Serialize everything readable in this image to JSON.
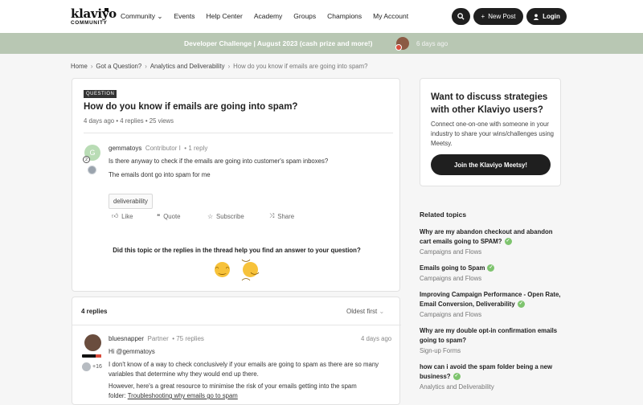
{
  "brand": {
    "name": "klaviyo",
    "sub": "COMMUNITY"
  },
  "nav": [
    "Community",
    "Events",
    "Help Center",
    "Academy",
    "Groups",
    "Champions",
    "My Account"
  ],
  "header_buttons": {
    "new_post": "New Post",
    "login": "Login"
  },
  "banner": {
    "text": "Developer Challenge | August 2023 (cash prize and more!)",
    "ago": "6 days ago"
  },
  "breadcrumb": [
    "Home",
    "Got a Question?",
    "Analytics and Deliverability",
    "How do you know if emails are going into spam?"
  ],
  "question": {
    "tag": "QUESTION",
    "title": "How do you know if emails are going into spam?",
    "meta": "4 days ago  •  4 replies  •  25 views",
    "author": "gemmatoys",
    "avatar_letter": "G",
    "level": "2",
    "role": "Contributor I",
    "reply_count": "• 1 reply",
    "body1": "Is there anyway to check if the emails are going into customer's spam inboxes?",
    "body2": "The emails dont go into spam for me",
    "label": "deliverability",
    "actions": {
      "like": "Like",
      "quote": "Quote",
      "subscribe": "Subscribe",
      "share": "Share"
    },
    "feedback": "Did this topic or the replies in the thread help you find an answer to your question?"
  },
  "replies": {
    "title": "4 replies",
    "sort": "Oldest first",
    "first": {
      "author": "bluesnapper",
      "role": "Partner",
      "replies": "• 75 replies",
      "date": "4 days ago",
      "badge_count": "+16",
      "greeting": "Hi @gemmatoys",
      "p1a": "I don't know of a way to check conclusively if your emails are going to spam as there are so many",
      "p1b": "variables that determine why they would end up there.",
      "p2a": "However, here's a great resource to minimise the risk of your emails getting into the spam",
      "p2b": "folder: ",
      "p2link": "Troubleshooting why emails go to spam"
    }
  },
  "sidebar": {
    "heading": "Want to discuss strategies with other Klaviyo users?",
    "text": "Connect one-on-one with someone in your industry to share your wins/challenges using Meetsy.",
    "cta": "Join the Klaviyo Meetsy!"
  },
  "related": {
    "heading": "Related topics",
    "items": [
      {
        "title": "Why are my abandon checkout and abandon cart emails going to SPAM?",
        "category": "Campaigns and Flows"
      },
      {
        "title": "Emails going to Spam",
        "category": "Campaigns and Flows"
      },
      {
        "title": "Improving Campaign Performance - Open Rate, Email Conversion, Deliverability",
        "category": "Campaigns and Flows"
      },
      {
        "title": "Why are my double opt-in confirmation emails going to spam?",
        "category": "Sign-up Forms"
      },
      {
        "title": "how can i avoid the spam folder being a new business?",
        "category": "Analytics and Deliverability"
      }
    ]
  }
}
